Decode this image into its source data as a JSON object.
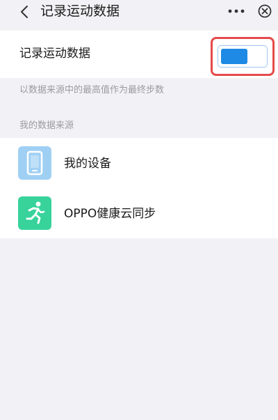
{
  "header": {
    "title": "记录运动数据",
    "back_icon": "chevron-left-icon",
    "more_icon": "more-icon",
    "close_icon": "close-circle-icon"
  },
  "setting": {
    "label": "记录运动数据",
    "toggle_on": true,
    "toggle_color": "#1f8ae6",
    "highlight_color": "#e64a4a",
    "description": "以数据来源中的最高值作为最终步数"
  },
  "sources": {
    "section_title": "我的数据来源",
    "items": [
      {
        "label": "我的设备",
        "icon": "phone-device-icon",
        "icon_color": "#9fd0f4"
      },
      {
        "label": "OPPO健康云同步",
        "icon": "running-person-icon",
        "icon_color": "#37d39a"
      }
    ]
  },
  "colors": {
    "background": "#f2f2f6",
    "surface": "#ffffff",
    "secondary_text": "#9a9aa0"
  }
}
